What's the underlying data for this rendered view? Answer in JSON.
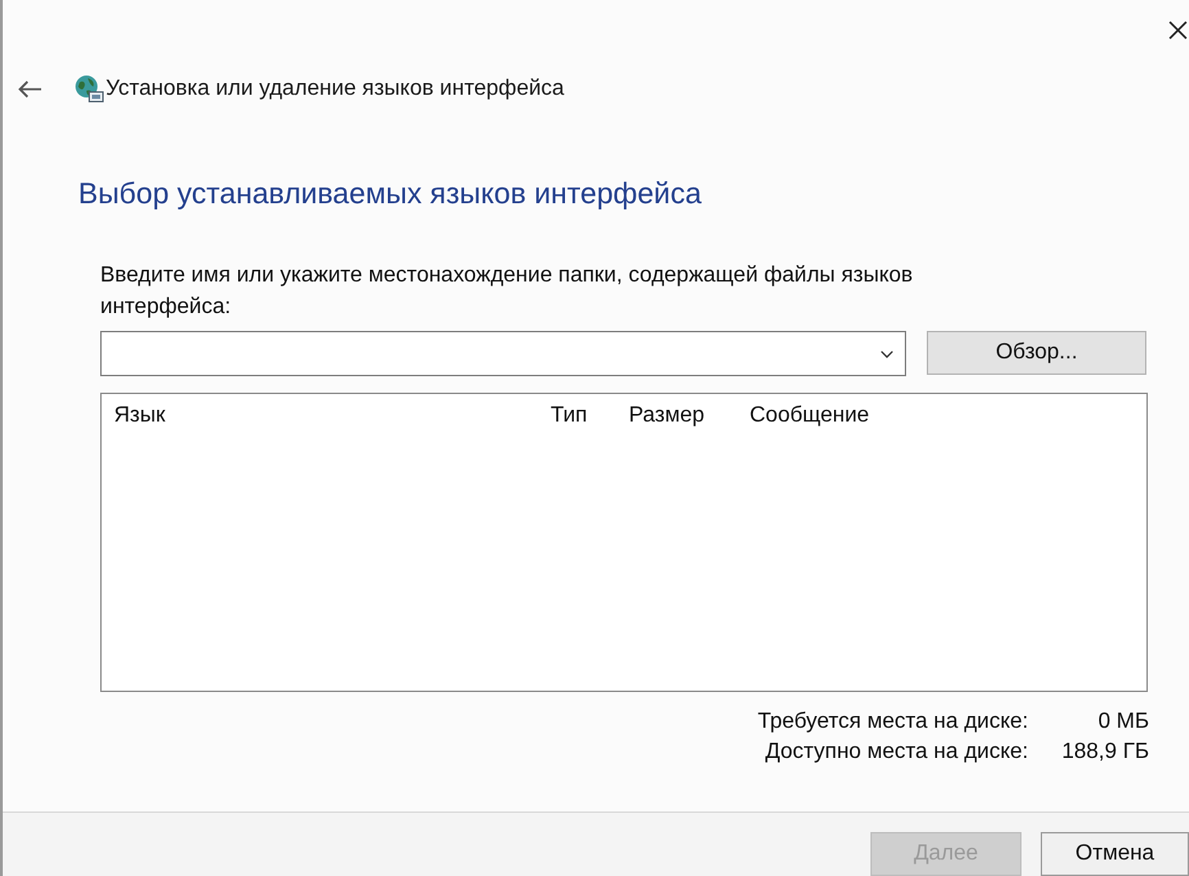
{
  "window": {
    "title": "Установка или удаление языков интерфейса"
  },
  "heading": "Выбор устанавливаемых языков интерфейса",
  "instruction": "Введите имя или укажите местонахождение папки, содержащей файлы языков интерфейса:",
  "browse_button": "Обзор...",
  "language_list": {
    "columns": [
      "Язык",
      "Тип",
      "Размер",
      "Сообщение"
    ]
  },
  "disk_space": [
    {
      "label": "Требуется места на диске:",
      "value": "0 МБ"
    },
    {
      "label": "Доступно места на диске:",
      "value": "188,9 ГБ"
    }
  ],
  "buttons": [
    {
      "label": "Далее",
      "disabled": true
    },
    {
      "label": "Отмена",
      "disabled": false
    }
  ]
}
